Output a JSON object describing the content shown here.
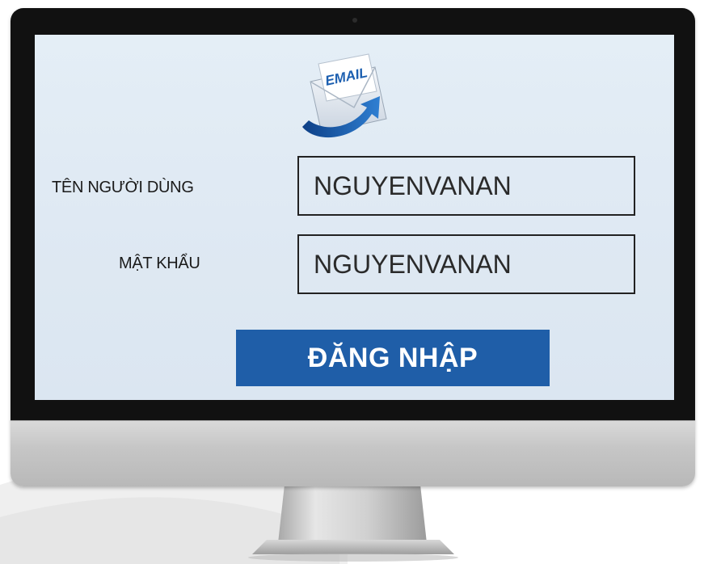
{
  "login_form": {
    "email_icon_text": "EMAIL",
    "username_label": "TÊN NGƯỜI DÙNG",
    "username_value": "NGUYENVANAN",
    "password_label": "MẬT KHẨU",
    "password_value": "NGUYENVANAN",
    "login_button_label": "ĐĂNG NHẬP"
  },
  "icons": {
    "email": "email-envelope-icon"
  },
  "colors": {
    "button": "#1f5ea8",
    "screen_background": "#e2ecf5",
    "bezel": "#111111",
    "chin": "#c6c6c6"
  }
}
